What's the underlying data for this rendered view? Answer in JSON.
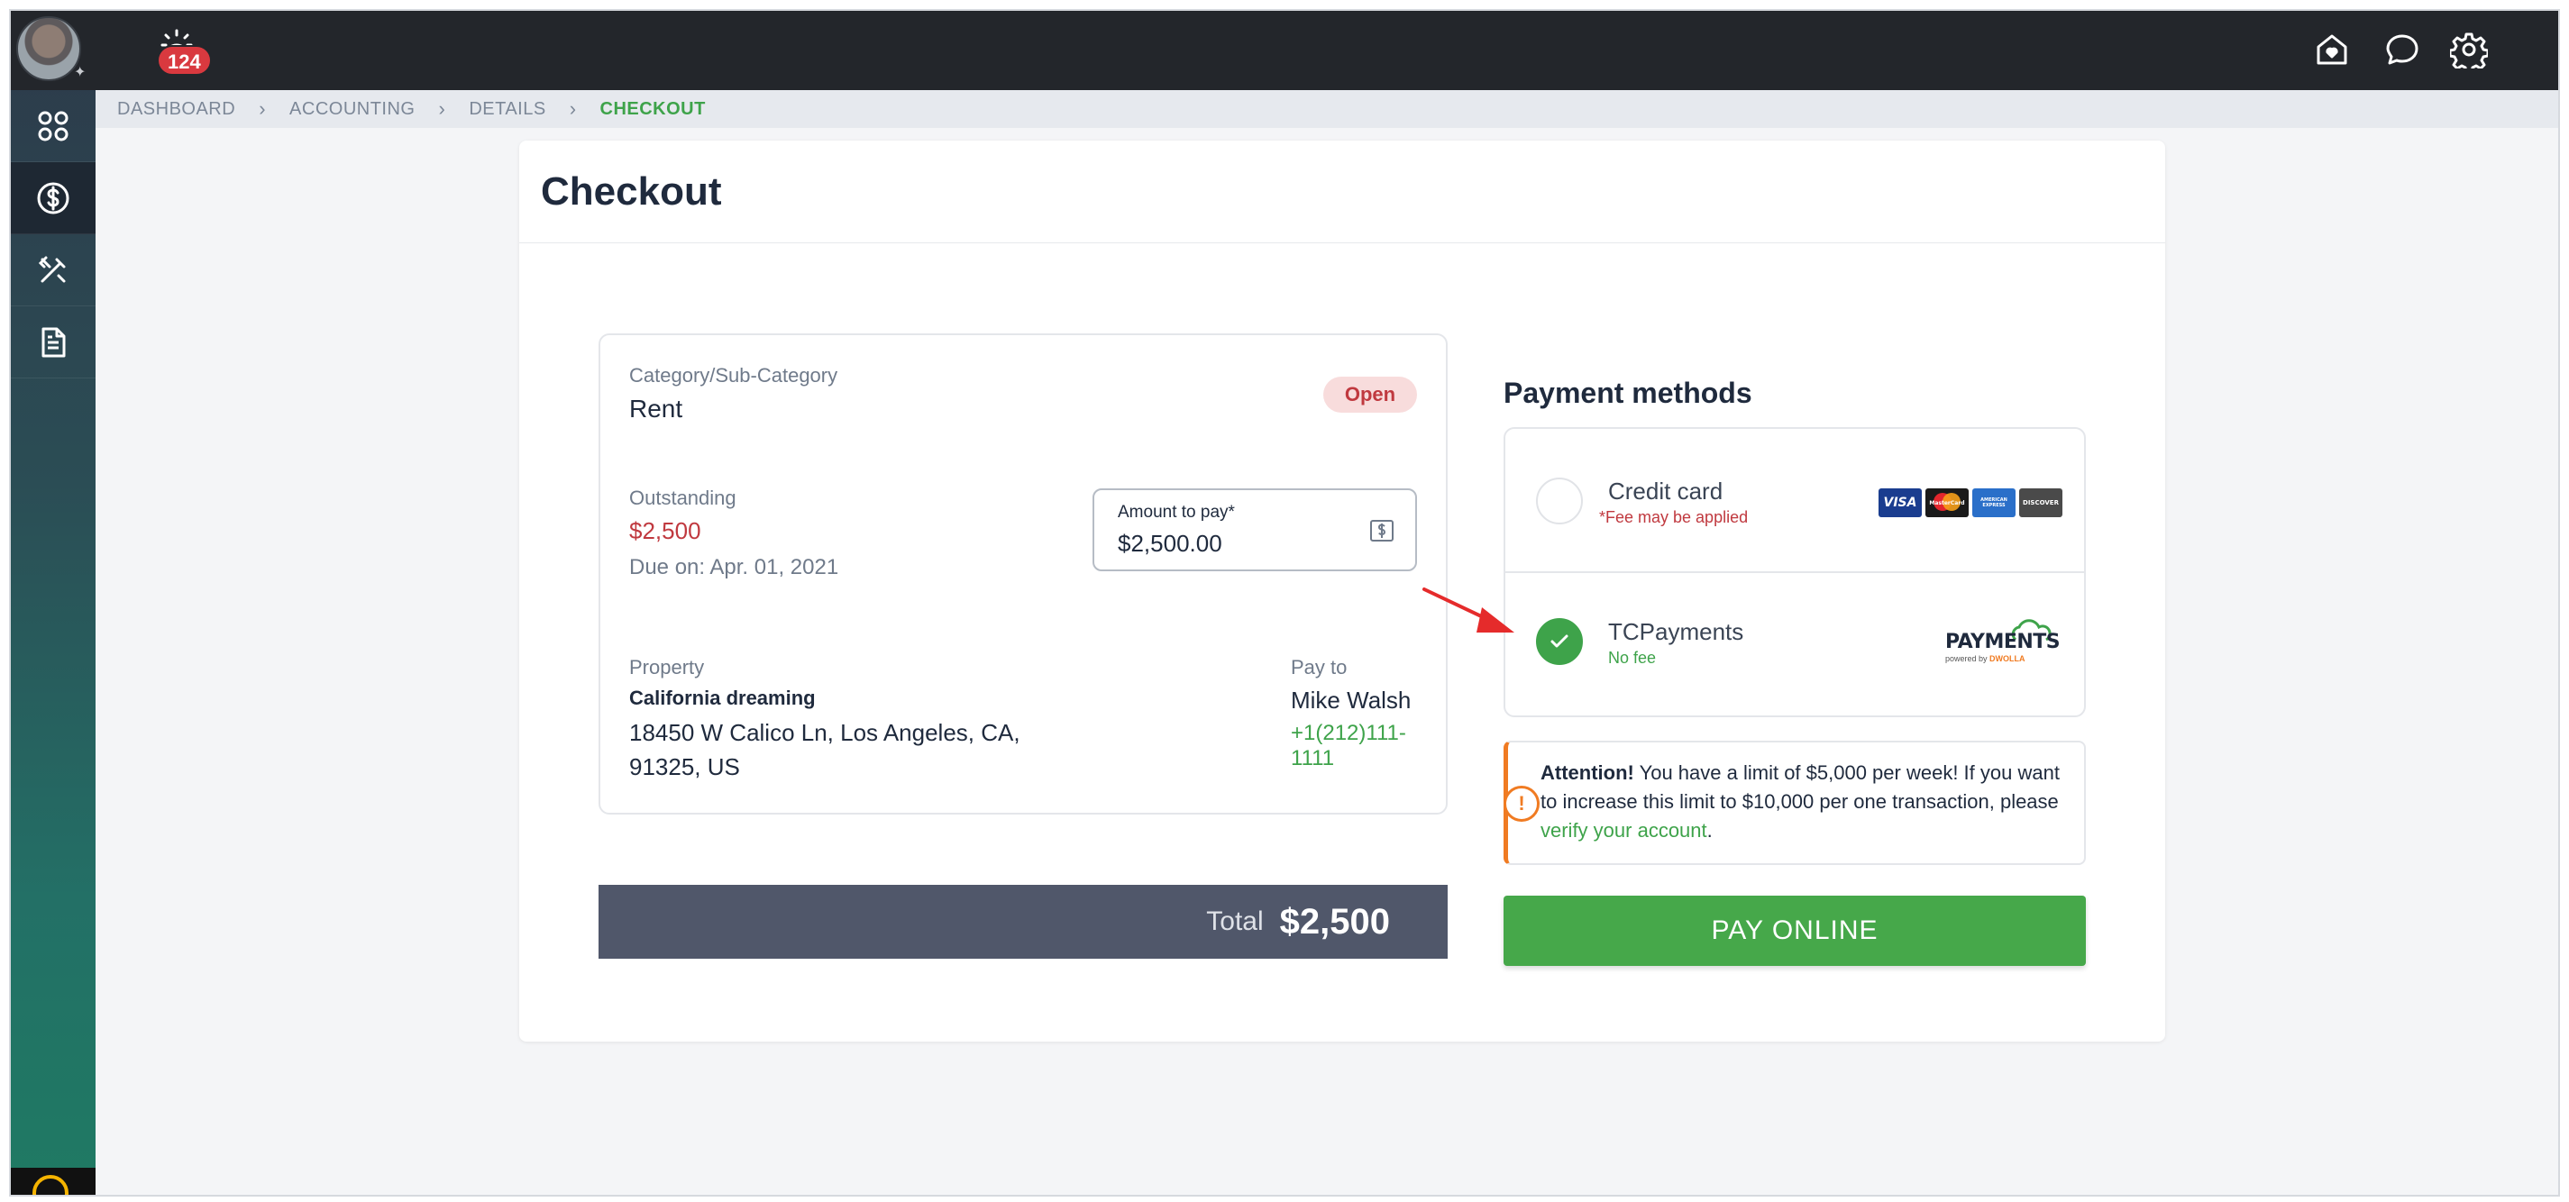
{
  "notifications": {
    "count": "124"
  },
  "breadcrumb": [
    "DASHBOARD",
    "ACCOUNTING",
    "DETAILS",
    "CHECKOUT"
  ],
  "page": {
    "title": "Checkout"
  },
  "details": {
    "category_label": "Category/Sub-Category",
    "category_value": "Rent",
    "status": "Open",
    "outstanding_label": "Outstanding",
    "outstanding_value": "$2,500",
    "due": "Due on: Apr. 01, 2021",
    "amount_label": "Amount to pay*",
    "amount_value": "$2,500.00",
    "property_label": "Property",
    "property_name": "California dreaming",
    "address_line1": "18450 W Calico Ln, Los Angeles, CA,",
    "address_line2": "91325, US",
    "payto_label": "Pay to",
    "payto_name": "Mike Walsh",
    "payto_phone": "+1(212)111-1111"
  },
  "total": {
    "label": "Total",
    "value": "$2,500"
  },
  "payment_methods": {
    "title": "Payment methods",
    "options": [
      {
        "name": "Credit card",
        "note": "*Fee may be applied",
        "selected": false,
        "logos": [
          "VISA",
          "MasterCard",
          "AMERICAN EXPRESS",
          "DISCOVER"
        ]
      },
      {
        "name": "TCPayments",
        "note": "No fee",
        "selected": true,
        "logo_text": "PAYMENTS",
        "logo_sub": "powered by",
        "logo_brand": "DWOLLA"
      }
    ]
  },
  "attention": {
    "bold": "Attention!",
    "text": " You have a limit of $5,000 per week! If you want to increase this limit to $10,000 per one transaction, please ",
    "link": "verify your account",
    "end": "."
  },
  "pay_button": "PAY ONLINE",
  "colors": {
    "accent": "#46a84a",
    "danger": "#c0393f",
    "warning": "#f07b22",
    "topbar": "#23262b"
  }
}
